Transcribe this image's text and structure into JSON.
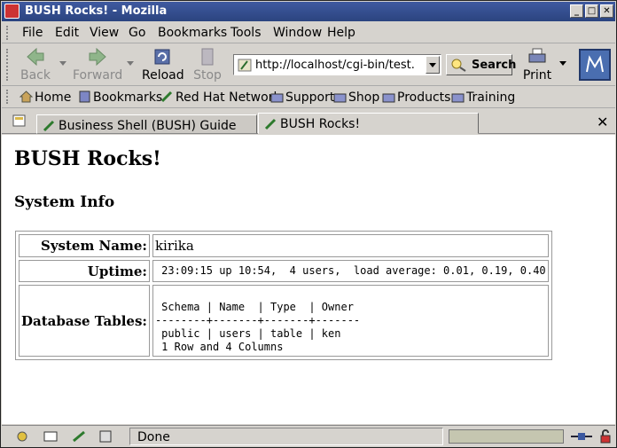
{
  "window": {
    "title": "BUSH Rocks! - Mozilla"
  },
  "menu": [
    "File",
    "Edit",
    "View",
    "Go",
    "Bookmarks",
    "Tools",
    "Window",
    "Help"
  ],
  "nav": {
    "back": "Back",
    "forward": "Forward",
    "reload": "Reload",
    "stop": "Stop",
    "url": "http://localhost/cgi-bin/test.cgi",
    "search": "Search",
    "print": "Print"
  },
  "personal_toolbar": [
    "Home",
    "Bookmarks",
    "Red Hat Network",
    "Support",
    "Shop",
    "Products",
    "Training"
  ],
  "tabs": [
    {
      "label": "Business Shell (BUSH) Guide",
      "active": false
    },
    {
      "label": "BUSH Rocks!",
      "active": true
    }
  ],
  "page": {
    "heading": "BUSH Rocks!",
    "section": "System Info",
    "rows": {
      "system_name_label": "System Name:",
      "system_name_value": "kirika",
      "uptime_label": "Uptime:",
      "uptime_value": " 23:09:15 up 10:54,  4 users,  load average: 0.01, 0.19, 0.40",
      "db_label": "Database Tables:",
      "db_value": "\n Schema | Name  | Type  | Owner\n--------+-------+-------+-------\n public | users | table | ken\n 1 Row and 4 Columns"
    }
  },
  "status": {
    "text": "Done",
    "progress": 0.0
  },
  "colors": {
    "titlebar": "#3f5aa0",
    "chrome": "#d6d3ce",
    "content": "#ffffff"
  },
  "icons": {
    "back": "left-arrow-icon",
    "forward": "right-arrow-icon",
    "reload": "reload-icon",
    "stop": "stop-icon",
    "search": "search-icon",
    "print": "printer-icon"
  }
}
